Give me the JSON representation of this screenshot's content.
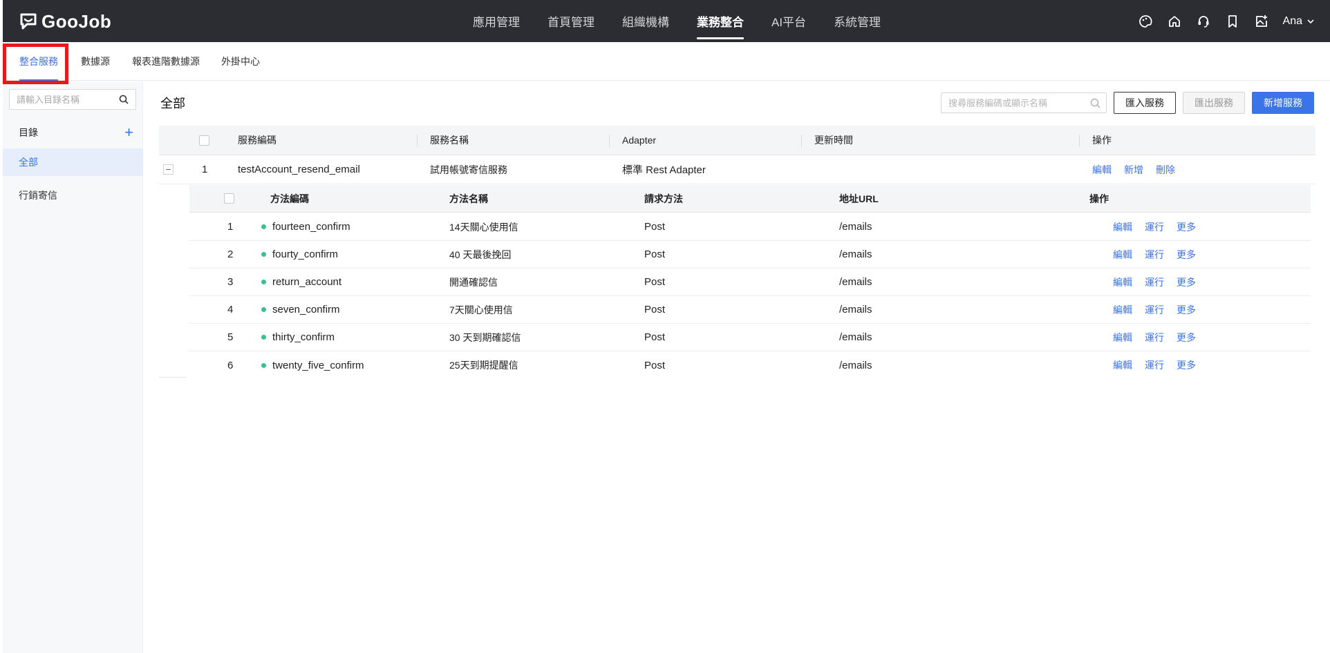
{
  "brand": {
    "name": "GooJob"
  },
  "topnav": {
    "items": [
      "應用管理",
      "首頁管理",
      "組織機構",
      "業務整合",
      "AI平台",
      "系統管理"
    ],
    "active_index": 3,
    "user": "Ana"
  },
  "subtabs": {
    "items": [
      "整合服務",
      "數據源",
      "報表進階數據源",
      "外掛中心"
    ],
    "active_index": 0
  },
  "sidebar": {
    "search_placeholder": "請輸入目錄名稱",
    "directory_label": "目錄",
    "items": [
      "全部",
      "行銷寄信"
    ],
    "active_index": 0
  },
  "main": {
    "title": "全部",
    "search_placeholder": "搜尋服務編碼或顯示名稱",
    "buttons": {
      "import": "匯入服務",
      "export": "匯出服務",
      "add": "新增服務"
    },
    "table": {
      "headers": [
        "服務編碼",
        "服務名稱",
        "Adapter",
        "更新時間",
        "操作"
      ],
      "rows": [
        {
          "index": "1",
          "code": "testAccount_resend_email",
          "name": "試用帳號寄信服務",
          "adapter": "標準 Rest Adapter",
          "updated": "",
          "actions": [
            "編輯",
            "新增",
            "刪除"
          ]
        }
      ]
    },
    "subtable": {
      "headers": [
        "方法編碼",
        "方法名稱",
        "請求方法",
        "地址URL",
        "操作"
      ],
      "actions": [
        "編輯",
        "運行",
        "更多"
      ],
      "rows": [
        {
          "index": "1",
          "code": "fourteen_confirm",
          "name": "14天關心使用信",
          "method": "Post",
          "url": "/emails"
        },
        {
          "index": "2",
          "code": "fourty_confirm",
          "name": "40 天最後挽回",
          "method": "Post",
          "url": "/emails"
        },
        {
          "index": "3",
          "code": "return_account",
          "name": "開通確認信",
          "method": "Post",
          "url": "/emails"
        },
        {
          "index": "4",
          "code": "seven_confirm",
          "name": "7天關心使用信",
          "method": "Post",
          "url": "/emails"
        },
        {
          "index": "5",
          "code": "thirty_confirm",
          "name": "30 天到期確認信",
          "method": "Post",
          "url": "/emails"
        },
        {
          "index": "6",
          "code": "twenty_five_confirm",
          "name": "25天到期提醒信",
          "method": "Post",
          "url": "/emails"
        }
      ]
    }
  },
  "colors": {
    "accent": "#3b73e8",
    "topbar": "#2b2d33",
    "status_dot": "#3bbf8c",
    "highlight": "#e8181f"
  }
}
